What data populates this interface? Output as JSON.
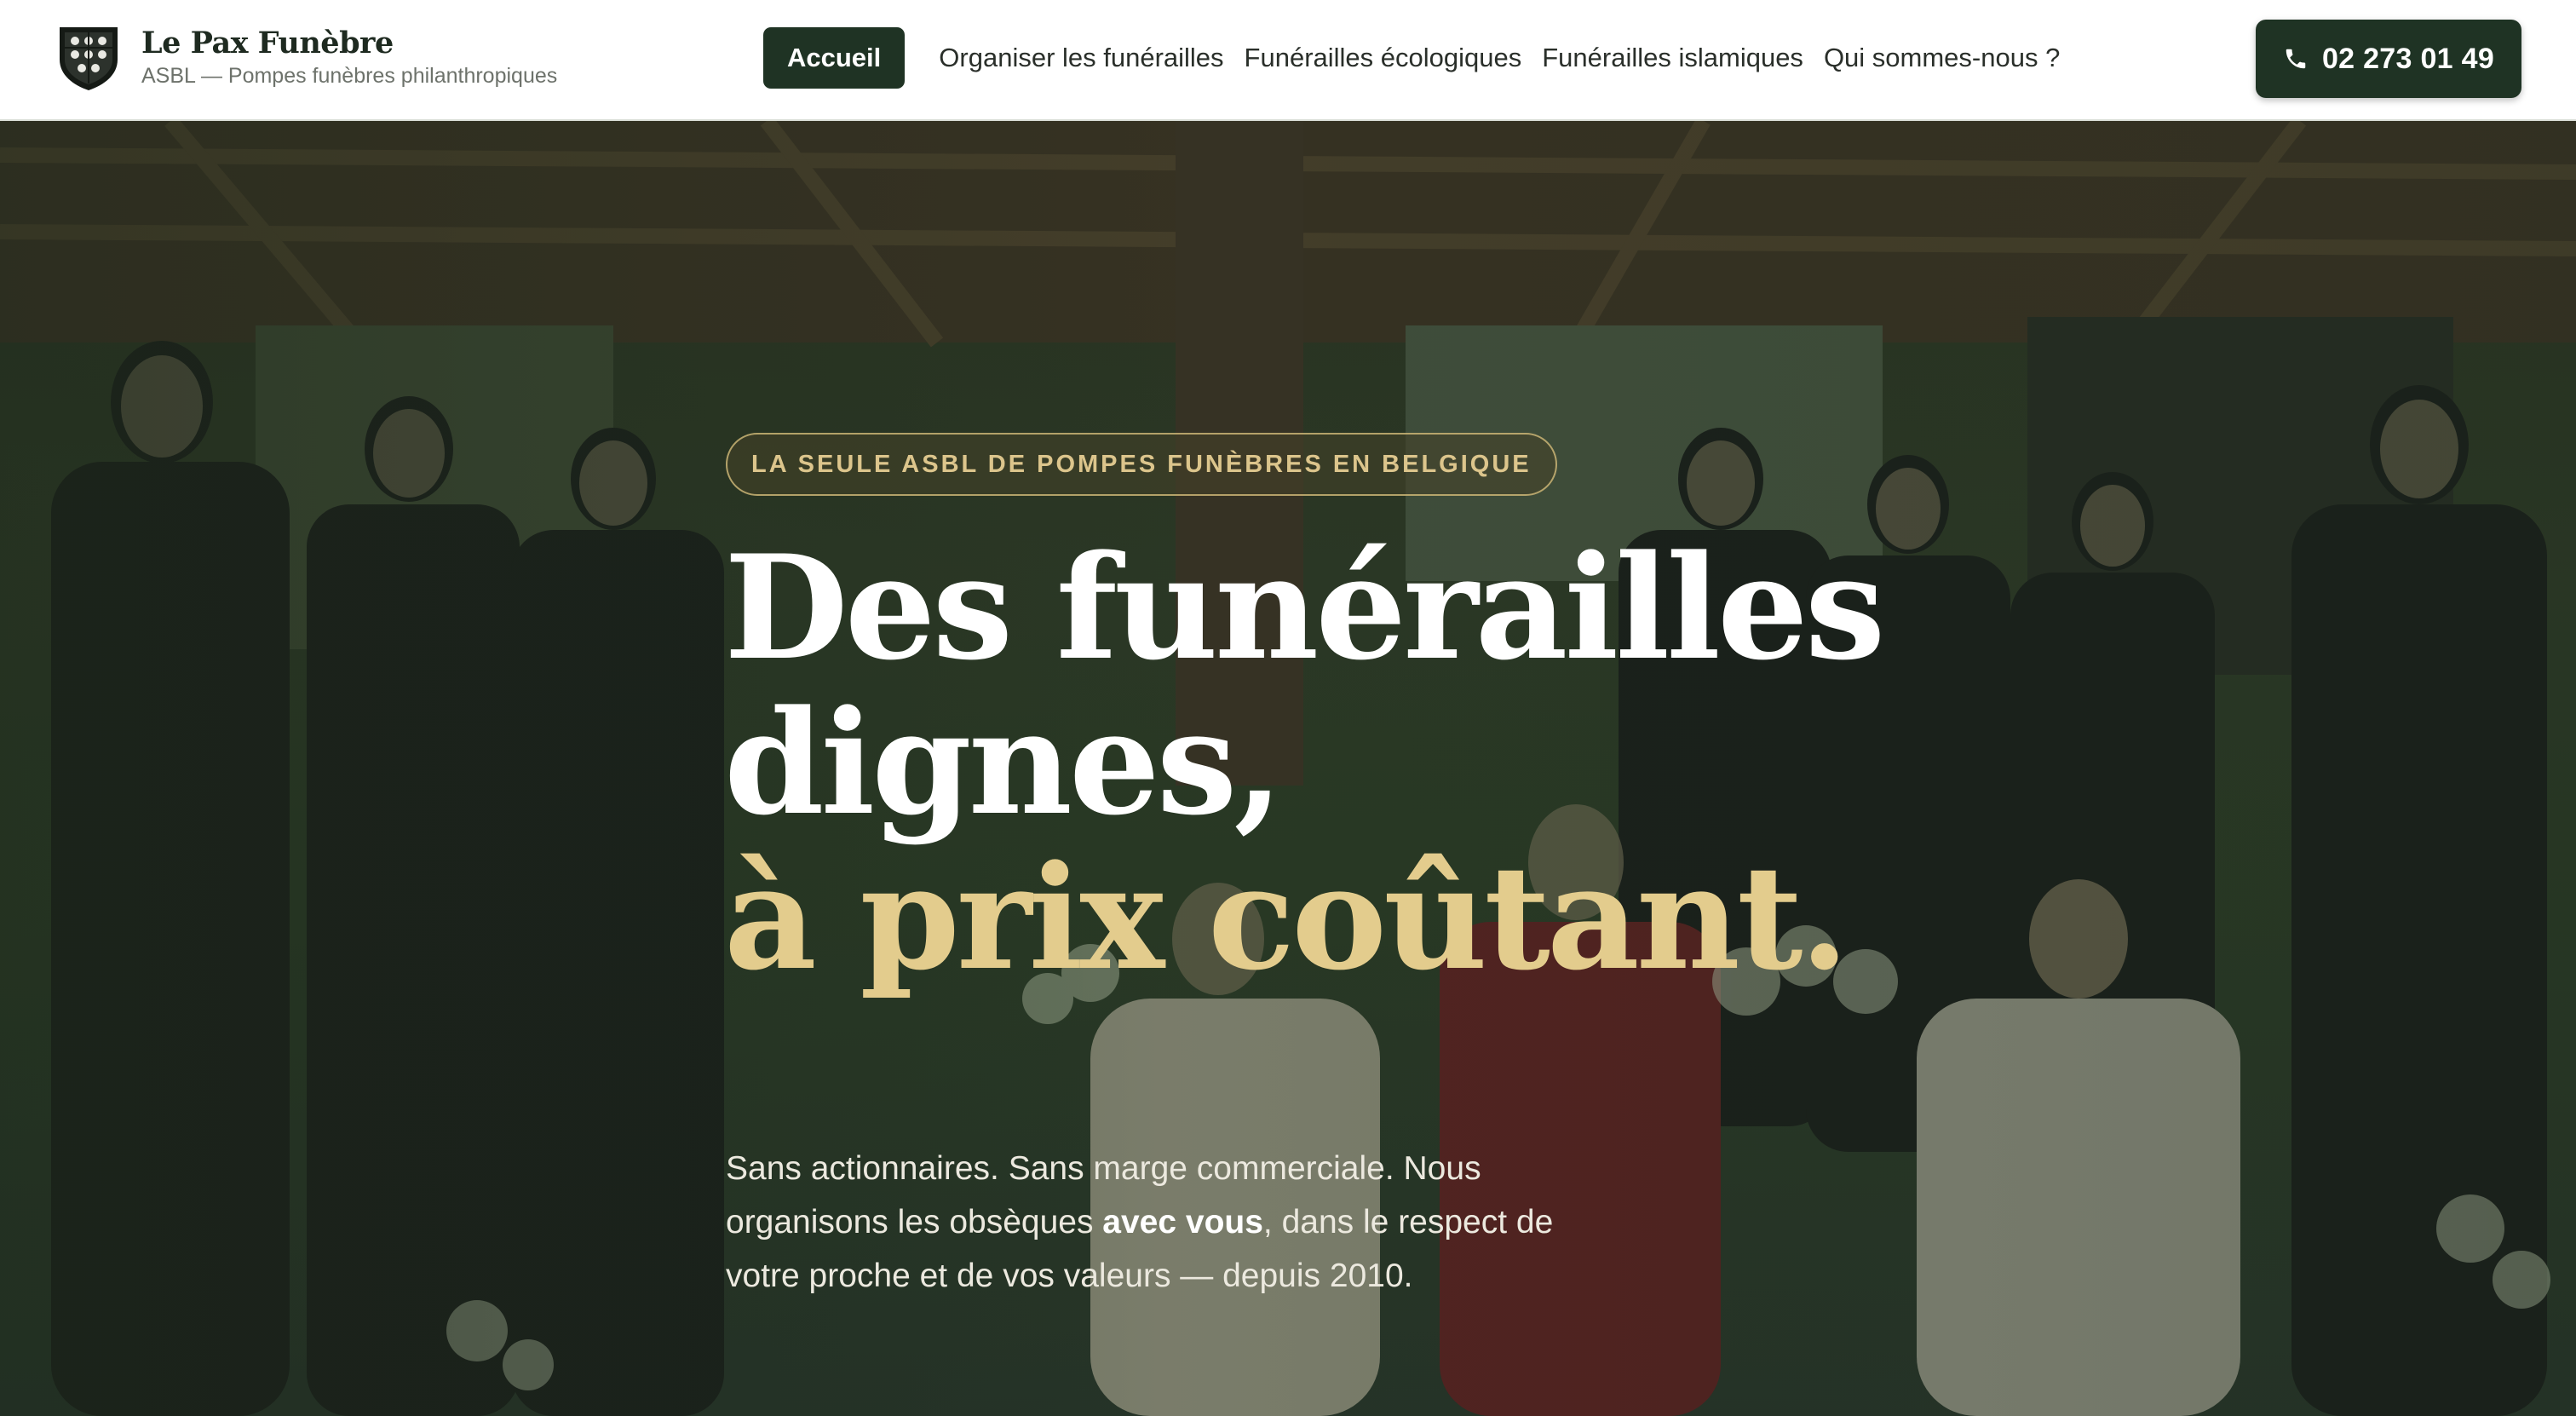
{
  "header": {
    "brand": {
      "title": "Le Pax Funèbre",
      "subtitle": "ASBL — Pompes funèbres philanthropiques",
      "logo_icon": "crest-shield-icon"
    },
    "nav": [
      {
        "label": "Accueil",
        "active": true
      },
      {
        "label": "Organiser les funérailles",
        "active": false
      },
      {
        "label": "Funérailles écologiques",
        "active": false
      },
      {
        "label": "Funérailles islamiques",
        "active": false
      },
      {
        "label": "Qui sommes-nous ?",
        "active": false
      }
    ],
    "phone": {
      "icon": "phone-icon",
      "number": "02 273 01 49"
    }
  },
  "hero": {
    "badge": "LA SEULE ASBL DE POMPES FUNÈBRES EN BELGIQUE",
    "headline": {
      "line1": "Des funérailles",
      "line2": "dignes,",
      "line3": "à prix coûtant."
    },
    "lead": {
      "part1": "Sans actionnaires. Sans marge commerciale. Nous organisons les obsèques ",
      "emphasis": "avec vous",
      "part2": ", dans le respect de votre proche et de vos valeurs — depuis 2010."
    },
    "background_image": "team-group-photo"
  },
  "colors": {
    "primary_dark": "#1f3324",
    "gold": "#e3cc8d",
    "badge_gold": "#dcc58c",
    "white": "#ffffff"
  }
}
